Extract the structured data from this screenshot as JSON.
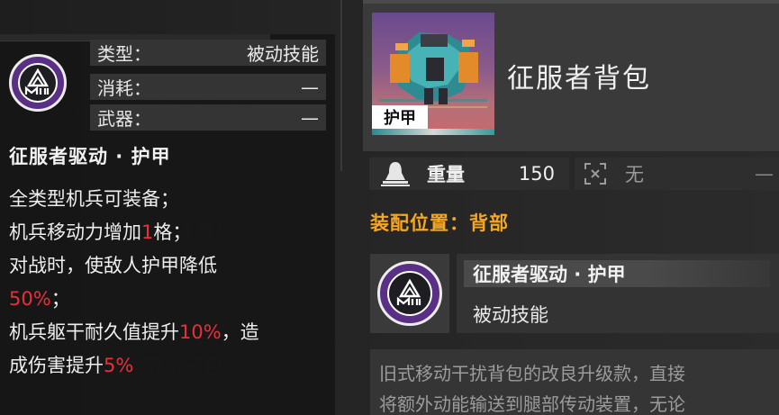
{
  "left_panel": {
    "attributes": [
      {
        "key": "类型：",
        "value": "被动技能"
      },
      {
        "key": "消耗：",
        "value": "—"
      },
      {
        "key": "武器：",
        "value": "—"
      }
    ],
    "skill_title": "征服者驱动 · 护甲",
    "description_lines": [
      [
        {
          "text": "全类型机兵可装备；",
          "red": false
        }
      ],
      [
        {
          "text": "机兵移动力增加",
          "red": false
        },
        {
          "text": "1",
          "red": true
        },
        {
          "text": "格；",
          "red": false
        }
      ],
      [
        {
          "text": "对战时，使敌人护甲降低",
          "red": false
        }
      ],
      [
        {
          "text": "50%",
          "red": true
        },
        {
          "text": "；",
          "red": false
        }
      ],
      [
        {
          "text": "机兵躯干耐久值提升",
          "red": false
        },
        {
          "text": "10%",
          "red": true
        },
        {
          "text": "，造",
          "red": false
        }
      ],
      [
        {
          "text": "成伤害提升",
          "red": false
        },
        {
          "text": "5%",
          "red": true
        }
      ]
    ]
  },
  "item": {
    "name": "征服者背包",
    "tag": "护甲",
    "weight_label": "重量",
    "weight_value": "150",
    "secondary_value": "无",
    "secondary_tail": "—",
    "mount_position": "装配位置：背部",
    "skill_card": {
      "title": "征服者驱动 · 护甲",
      "type": "被动技能"
    },
    "description_lines": [
      "旧式移动干扰背包的改良升级款，直接",
      "将额外动能输送到腿部传动装置，无论"
    ]
  },
  "colors": {
    "accent_orange": "#f5a623",
    "highlight_red": "#e9303a",
    "skill_purple": "#5a2f86"
  }
}
